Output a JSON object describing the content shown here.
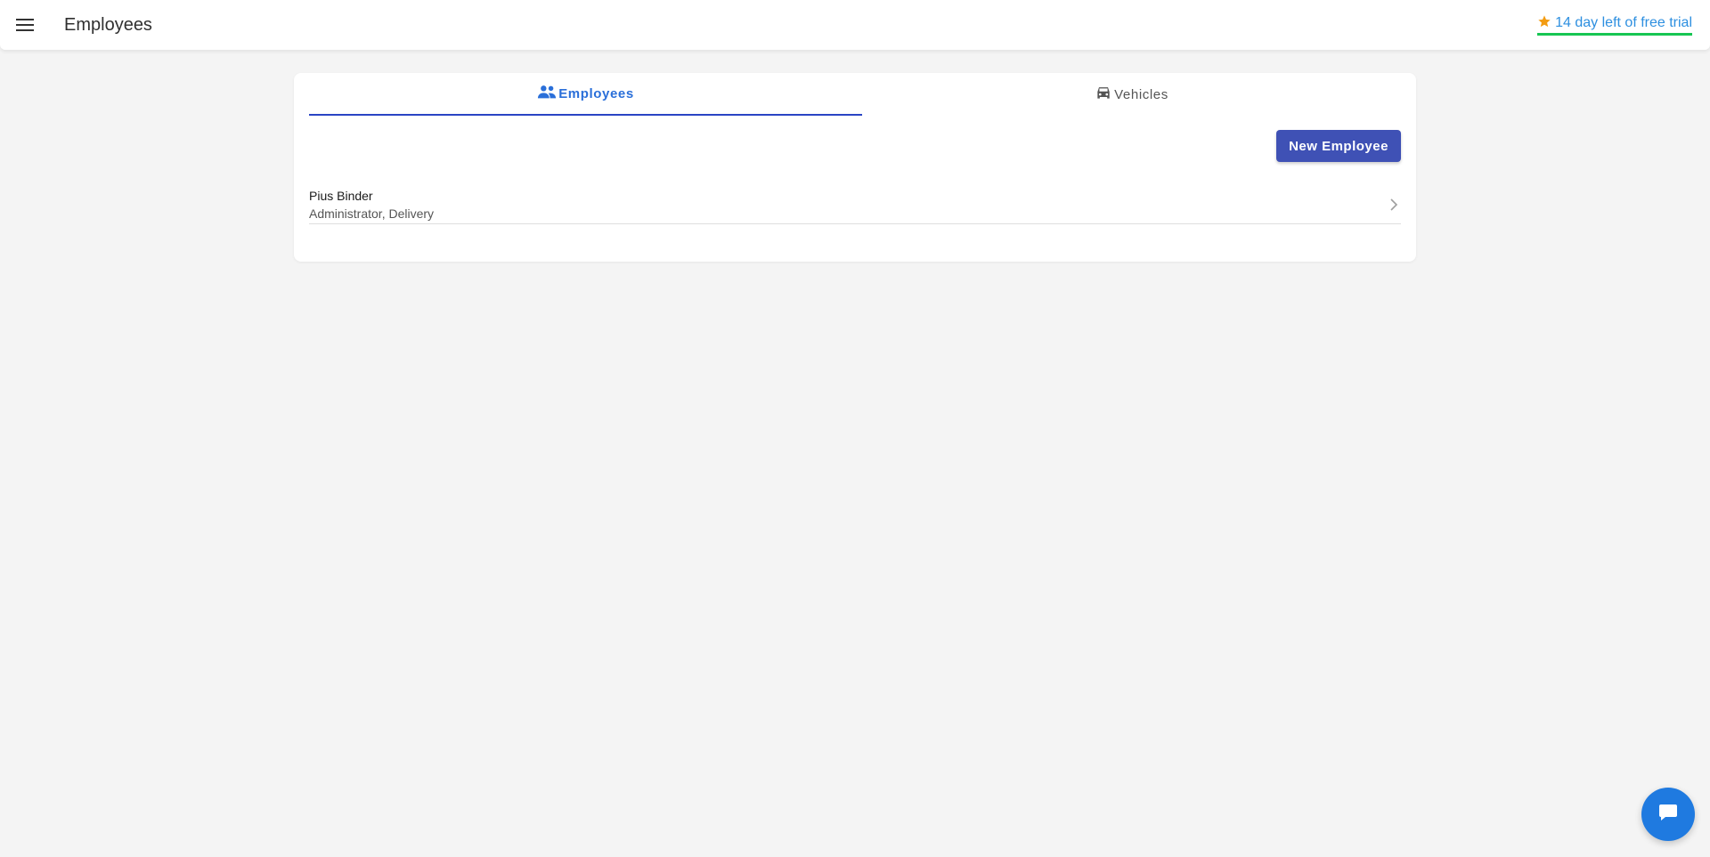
{
  "header": {
    "title": "Employees",
    "menu_icon": "hamburger-menu-icon",
    "trial": {
      "icon": "star-icon",
      "text": "14 day left of free trial"
    }
  },
  "tabs": [
    {
      "label": "Employees",
      "icon": "people-icon",
      "active": true
    },
    {
      "label": "Vehicles",
      "icon": "car-icon",
      "active": false
    }
  ],
  "actions": {
    "new_employee_label": "New Employee"
  },
  "employees": [
    {
      "name": "Pius Binder",
      "roles": "Administrator, Delivery"
    }
  ],
  "chat": {
    "icon": "chat-bubble-icon"
  },
  "colors": {
    "accent": "#3f51b5",
    "active_tab": "#2a6fd9",
    "trial_link": "#2d8fe0",
    "trial_underline": "#17c653",
    "star": "#f39c12",
    "chat_button": "#1f7ae0"
  }
}
